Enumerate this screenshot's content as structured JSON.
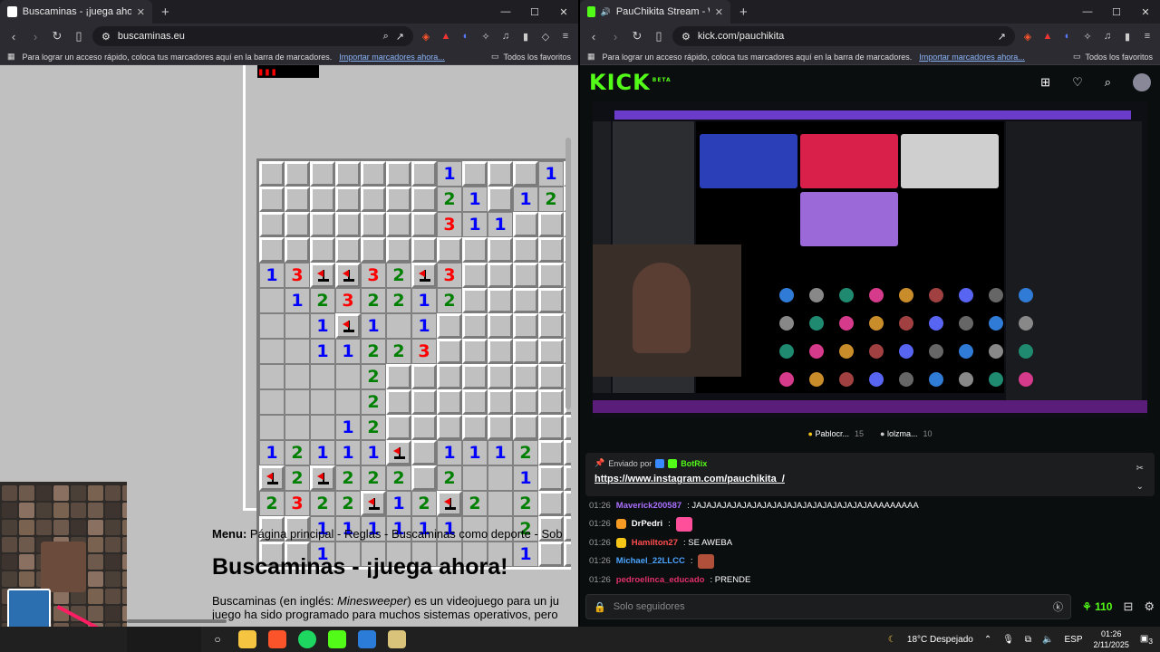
{
  "left_browser": {
    "tab_title": "Buscaminas - ¡juega ahora!",
    "url": "buscaminas.eu",
    "bookmarks_hint": "Para lograr un acceso rápido, coloca tus marcadores aquí en la barra de marcadores.",
    "import_link": "Importar marcadores ahora...",
    "all_favorites": "Todos los favoritos",
    "window_controls": [
      "—",
      "☐",
      "✕"
    ]
  },
  "minesweeper": {
    "counter": "▮▮▮",
    "rows": [
      [
        "c",
        "c",
        "c",
        "c",
        "c",
        "c",
        "c",
        "1",
        "c",
        "c",
        "c",
        "1",
        "c"
      ],
      [
        "c",
        "c",
        "c",
        "c",
        "c",
        "c",
        "c",
        "2",
        "1",
        "c",
        "1",
        "2",
        "c"
      ],
      [
        "c",
        "c",
        "c",
        "c",
        "c",
        "c",
        "c",
        "3",
        "1",
        "1",
        "c",
        "c",
        "c"
      ],
      [
        "c",
        "c",
        "c",
        "c",
        "c",
        "c",
        "c",
        "c",
        "c",
        "c",
        "c",
        "c",
        "c"
      ],
      [
        "1",
        "3",
        "F",
        "F",
        "3",
        "2",
        "F",
        "3",
        "c",
        "c",
        "c",
        "c",
        "c"
      ],
      [
        "o",
        "1",
        "2",
        "3",
        "2",
        "2",
        "1",
        "2",
        "c",
        "c",
        "c",
        "c",
        "c"
      ],
      [
        "o",
        "o",
        "1",
        "F",
        "1",
        "o",
        "1",
        "c",
        "c",
        "c",
        "c",
        "c",
        "c"
      ],
      [
        "o",
        "o",
        "1",
        "1",
        "2",
        "2",
        "3",
        "c",
        "c",
        "c",
        "c",
        "c",
        "c"
      ],
      [
        "o",
        "o",
        "o",
        "o",
        "2",
        "c",
        "c",
        "c",
        "c",
        "c",
        "c",
        "c",
        "c"
      ],
      [
        "o",
        "o",
        "o",
        "o",
        "2",
        "c",
        "c",
        "c",
        "c",
        "c",
        "c",
        "c",
        "c"
      ],
      [
        "o",
        "o",
        "o",
        "1",
        "2",
        "c",
        "c",
        "c",
        "c",
        "c",
        "c",
        "c",
        "c"
      ],
      [
        "1",
        "2",
        "1",
        "1",
        "1",
        "F",
        "c",
        "1",
        "1",
        "1",
        "2",
        "c",
        "c"
      ],
      [
        "F",
        "2",
        "F",
        "2",
        "2",
        "2",
        "c",
        "2",
        "o",
        "o",
        "1",
        "c",
        "c"
      ],
      [
        "2",
        "3",
        "2",
        "2",
        "F",
        "1",
        "2",
        "F",
        "2",
        "o",
        "2",
        "c",
        "c"
      ],
      [
        "c",
        "c",
        "1",
        "1",
        "1",
        "1",
        "1",
        "1",
        "o",
        "o",
        "2",
        "c",
        "c"
      ],
      [
        "c",
        "c",
        "1",
        "o",
        "o",
        "o",
        "o",
        "o",
        "o",
        "o",
        "1",
        "c",
        "c"
      ]
    ]
  },
  "page_text": {
    "menu_label": "Menu:",
    "menu_items": "Página principal - Reglas - Buscaminas como deporte - Sob",
    "title": "Buscaminas - ¡juega ahora!",
    "intro_before": "Buscaminas (en inglés: ",
    "intro_em": "Minesweeper",
    "intro_after": ") es un videojuego para un ju",
    "intro_line2": "juego ha sido programado para muchos sistemas operativos, pero"
  },
  "right_browser": {
    "tab_title": "PauChikita Stream - Watch Li",
    "url": "kick.com/pauchikita",
    "bookmarks_hint": "Para lograr un acceso rápido, coloca tus marcadores aquí en la barra de marcadores.",
    "import_link": "Importar marcadores ahora...",
    "all_favorites": "Todos los favoritos"
  },
  "kick": {
    "logo": "KICK",
    "logo_beta": "BETA",
    "leaderboard": [
      {
        "name": "Pablocr...",
        "count": "15"
      },
      {
        "name": "lolzma...",
        "count": "10"
      }
    ],
    "pinned": {
      "sent_by": "Enviado por",
      "bot": "BotRix",
      "link": "https://www.instagram.com/pauchikita_/"
    },
    "chat": [
      {
        "time": "01:26",
        "user": "Maverick200587",
        "color": "#a970ff",
        "text": ": JAJAJAJAJAJAJAJAJAJAJAJAJAJAJAJAJAJAAAAAAAAA"
      },
      {
        "time": "01:26",
        "user": "DrPedri",
        "color": "#ffffff",
        "text": ":"
      },
      {
        "time": "01:26",
        "user": "Hamilton27",
        "color": "#ff4d4d",
        "text": ": SE AWEBA"
      },
      {
        "time": "01:26",
        "user": "Michael_22LLCC",
        "color": "#4aa3ff",
        "text": ":"
      },
      {
        "time": "01:26",
        "user": "pedroelinca_educado",
        "color": "#e0306a",
        "text": ": PRENDE"
      }
    ],
    "chat_placeholder": "Solo seguidores",
    "points": "110"
  },
  "taskbar": {
    "weather": "18°C  Despejado",
    "lang": "ESP",
    "time": "01:26",
    "date": "2/11/2025",
    "notif": "3"
  }
}
